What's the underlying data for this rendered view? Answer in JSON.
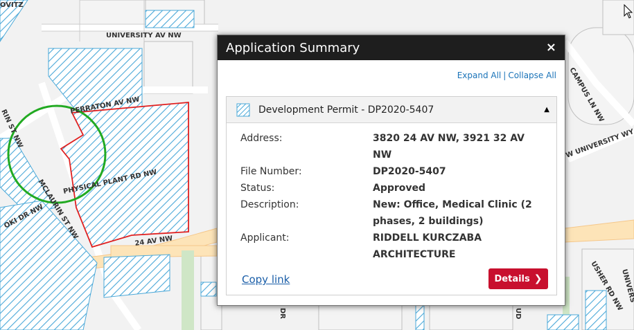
{
  "map": {
    "streets": [
      {
        "id": "university-av-nw",
        "label": "UNIVERSITY AV NW"
      },
      {
        "id": "campus-ln-nw",
        "label": "CAMPUS LN NW"
      },
      {
        "id": "university-wy",
        "label": "W UNIVERSITY WY"
      },
      {
        "id": "perraton-av-nw",
        "label": "PERRATON AV NW"
      },
      {
        "id": "physical-plant-rd-nw",
        "label": "PHYSICAL PLANT RD NW"
      },
      {
        "id": "mclaurin-st-nw",
        "label": "MCLAURIN ST NW"
      },
      {
        "id": "oki-dr-nw",
        "label": "OKI DR NW"
      },
      {
        "id": "24-av-nw",
        "label": "24 AV NW"
      },
      {
        "id": "usher-rd-nw",
        "label": "USHER RD NW"
      },
      {
        "id": "rin-st-nw",
        "label": "RIN ST NW"
      },
      {
        "id": "univers",
        "label": "UNIVERS"
      },
      {
        "id": "ud",
        "label": "UD"
      },
      {
        "id": "ovitz",
        "label": "OVITZ"
      },
      {
        "id": "dr",
        "label": "DR"
      }
    ],
    "colors": {
      "hatch": "#4aa8d8",
      "parcel_outline": "#e02020",
      "highlight_circle": "#22aa22",
      "road_fill": "#fde4b8"
    }
  },
  "popup": {
    "title": "Application Summary",
    "close_label": "×",
    "expand_all": "Expand All",
    "separator": "|",
    "collapse_all": "Collapse All",
    "permit": {
      "heading": "Development Permit - DP2020-5407",
      "toggle_glyph": "▲",
      "fields": [
        {
          "label": "Address:",
          "value": "3820 24 AV NW, 3921 32 AV NW"
        },
        {
          "label": "File Number:",
          "value": "DP2020-5407"
        },
        {
          "label": "Status:",
          "value": "Approved"
        },
        {
          "label": "Description:",
          "value": "New: Office, Medical Clinic (2 phases, 2 buildings)"
        },
        {
          "label": "Applicant:",
          "value": "RIDDELL KURCZABA ARCHITECTURE"
        }
      ]
    },
    "copy_link": "Copy link",
    "details_button": "Details",
    "details_chevron": "❯"
  }
}
